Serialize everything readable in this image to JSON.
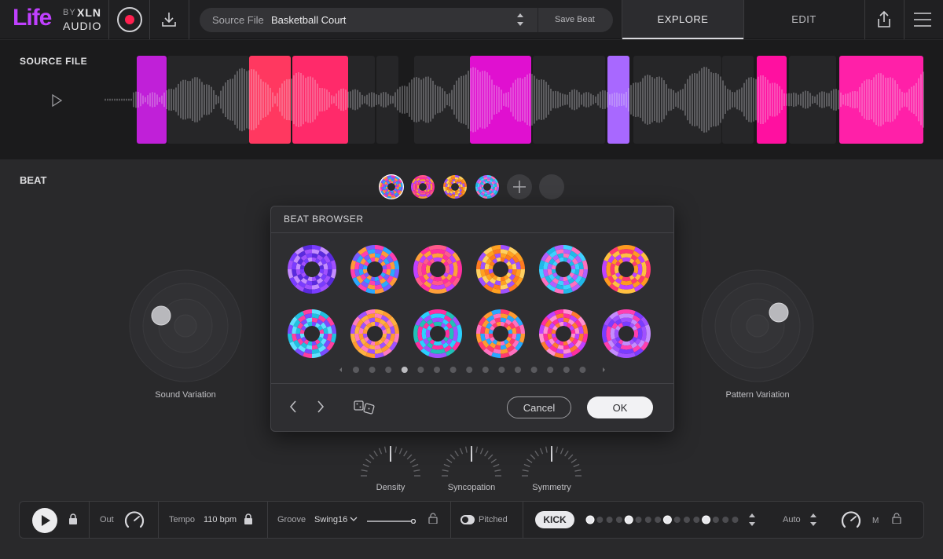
{
  "header": {
    "logo_life": "Life",
    "logo_by": "BY",
    "logo_xln": "XLN",
    "logo_audio": "AUDIO",
    "source_label": "Source File",
    "source_value": "Basketball Court",
    "save_beat": "Save Beat",
    "tab_explore": "EXPLORE",
    "tab_edit": "EDIT"
  },
  "source_strip": {
    "title": "SOURCE FILE"
  },
  "beat": {
    "title": "BEAT",
    "sound_variation": "Sound Variation",
    "pattern_variation": "Pattern Variation",
    "knobs": [
      "Density",
      "Syncopation",
      "Symmetry"
    ]
  },
  "beat_browser": {
    "title": "BEAT BROWSER",
    "cancel": "Cancel",
    "ok": "OK",
    "page_count": 15,
    "current_page": 4
  },
  "transport": {
    "out": "Out",
    "tempo_label": "Tempo",
    "tempo_value": "110 bpm",
    "groove_label": "Groove",
    "groove_value": "Swing16",
    "pitched": "Pitched",
    "kick": "KICK",
    "auto": "Auto",
    "m": "M"
  },
  "colors": {
    "accent_purple": "#c040ff",
    "record_red": "#ff1f4f",
    "magenta": "#e010d0",
    "hot_pink": "#ff2090",
    "coral": "#ff4060",
    "violet": "#b070ff"
  }
}
